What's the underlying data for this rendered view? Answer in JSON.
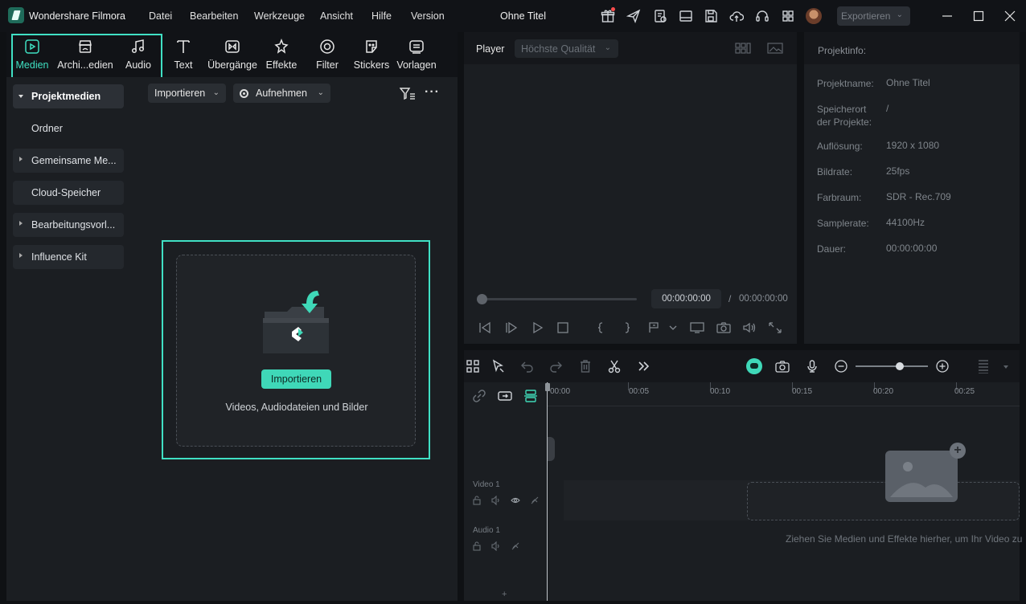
{
  "titlebar": {
    "app_name": "Wondershare Filmora",
    "menu": [
      "Datei",
      "Bearbeiten",
      "Werkzeuge",
      "Ansicht",
      "Hilfe",
      "Version"
    ],
    "document_title": "Ohne Titel",
    "export_label": "Exportieren"
  },
  "media_tabs": [
    {
      "label": "Medien",
      "icon": "media-icon",
      "active": true
    },
    {
      "label": "Archi...edien",
      "icon": "archive-icon",
      "active": false
    },
    {
      "label": "Audio",
      "icon": "music-note-icon",
      "active": false
    },
    {
      "label": "Text",
      "icon": "text-icon",
      "active": false
    },
    {
      "label": "Übergänge",
      "icon": "transition-icon",
      "active": false
    },
    {
      "label": "Effekte",
      "icon": "effects-icon",
      "active": false
    },
    {
      "label": "Filter",
      "icon": "filter-icon",
      "active": false
    },
    {
      "label": "Stickers",
      "icon": "sticker-icon",
      "active": false
    },
    {
      "label": "Vorlagen",
      "icon": "templates-icon",
      "active": false
    }
  ],
  "sidebar": {
    "items": [
      {
        "label": "Projektmedien"
      },
      {
        "label": "Ordner"
      },
      {
        "label": "Gemeinsame Me..."
      },
      {
        "label": "Cloud-Speicher"
      },
      {
        "label": "Bearbeitungsvorl..."
      },
      {
        "label": "Influence Kit"
      }
    ]
  },
  "media_toolbar": {
    "import_label": "Importieren",
    "record_label": "Aufnehmen"
  },
  "dropzone": {
    "button_label": "Importieren",
    "caption": "Videos, Audiodateien und Bilder"
  },
  "player": {
    "label": "Player",
    "quality": "Höchste Qualität",
    "timecode": "00:00:00:00",
    "separator": "/",
    "total": "00:00:00:00"
  },
  "project_info": {
    "title": "Projektinfo:",
    "rows": [
      {
        "key": "Projektname:",
        "value": "Ohne Titel"
      },
      {
        "key": "Speicherort der Projekte:",
        "value": "/"
      },
      {
        "key": "Auflösung:",
        "value": "1920 x 1080"
      },
      {
        "key": "Bildrate:",
        "value": "25fps"
      },
      {
        "key": "Farbraum:",
        "value": "SDR - Rec.709"
      },
      {
        "key": "Samplerate:",
        "value": "44100Hz"
      },
      {
        "key": "Dauer:",
        "value": "00:00:00:00"
      }
    ]
  },
  "timeline": {
    "ruler": [
      "00:00",
      "00:05",
      "00:10",
      "00:15",
      "00:20",
      "00:25"
    ],
    "tracks": {
      "video": "Video 1",
      "audio": "Audio 1"
    },
    "hint": "Ziehen Sie Medien und Effekte hierher, um Ihr Video zu",
    "add_label": "+"
  },
  "colors": {
    "accent": "#3fd8b8",
    "highlight": "#40e0c4",
    "background": "#1b1e22"
  }
}
